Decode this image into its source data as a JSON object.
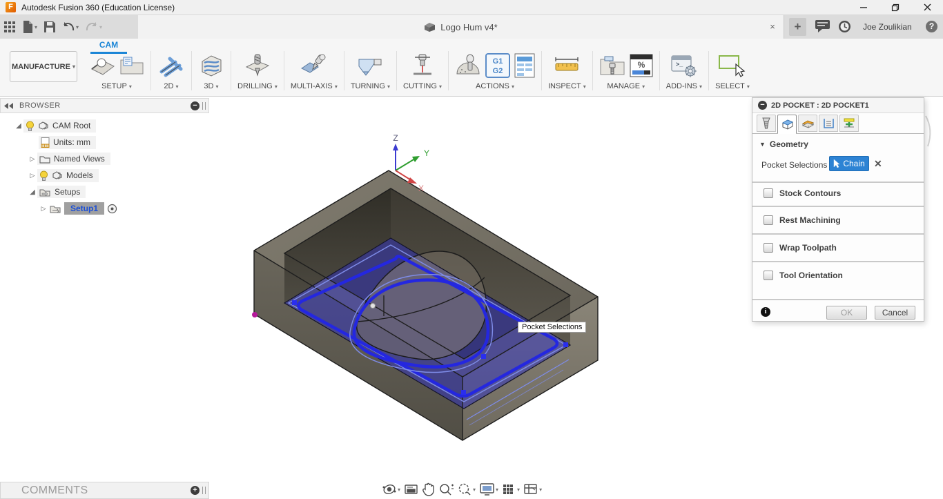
{
  "titlebar": {
    "title": "Autodesk Fusion 360 (Education License)",
    "logo_letter": "F"
  },
  "qat": {
    "doc_tab_title": "Logo Hum v4*",
    "new_tab_glyph": "+",
    "close_tab_glyph": "×",
    "user_name": "Joe Zoulikian",
    "help_glyph": "?"
  },
  "ribbon": {
    "workspace_label": "MANUFACTURE",
    "active_tab": "CAM",
    "groups": [
      {
        "label": "SETUP"
      },
      {
        "label": "2D"
      },
      {
        "label": "3D"
      },
      {
        "label": "DRILLING"
      },
      {
        "label": "MULTI-AXIS"
      },
      {
        "label": "TURNING"
      },
      {
        "label": "CUTTING"
      },
      {
        "label": "ACTIONS"
      },
      {
        "label": "INSPECT"
      },
      {
        "label": "MANAGE"
      },
      {
        "label": "ADD-INS"
      },
      {
        "label": "SELECT"
      }
    ],
    "icon_text": {
      "g1": "G1",
      "g2": "G2",
      "percent": "%",
      "prompt": ">_"
    }
  },
  "browser": {
    "title": "BROWSER",
    "collapse_glyph": "−",
    "items": [
      {
        "label": "CAM Root"
      },
      {
        "label": "Units: mm"
      },
      {
        "label": "Named Views"
      },
      {
        "label": "Models"
      },
      {
        "label": "Setups"
      },
      {
        "label": "Setup1"
      }
    ]
  },
  "dialog": {
    "title": "2D POCKET : 2D POCKET1",
    "collapse_glyph": "−",
    "section_title": "Geometry",
    "pocket_selections_label": "Pocket Selections",
    "chain_button_label": "Chain",
    "remove_glyph": "✕",
    "checkboxes": [
      {
        "label": "Stock Contours",
        "checked": false
      },
      {
        "label": "Rest Machining",
        "checked": false
      },
      {
        "label": "Wrap Toolpath",
        "checked": false
      },
      {
        "label": "Tool Orientation",
        "checked": false
      }
    ],
    "info_glyph": "i",
    "ok_label": "OK",
    "cancel_label": "Cancel"
  },
  "viewport": {
    "tooltip": "Pocket Selections",
    "axis": {
      "x": "X",
      "y": "Y",
      "z": "Z"
    }
  },
  "comments": {
    "title": "COMMENTS",
    "expand_glyph": "+"
  },
  "colors": {
    "accent_blue": "#1a85d6",
    "selection_chain_blue": "#2427e0",
    "selection_overlay_blue": "#2b2fc9",
    "thin_contour_blue": "#7e8ce8",
    "chain_button_blue": "#2d83d4",
    "setup_selected_text": "#1b4fd6",
    "grip_magenta": "#b5199a"
  }
}
